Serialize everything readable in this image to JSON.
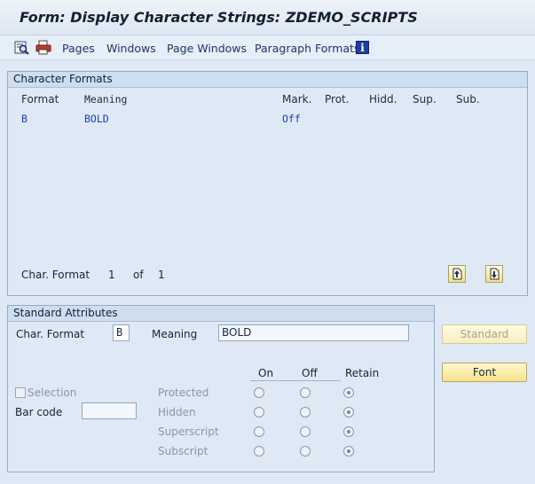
{
  "window": {
    "title": "Form: Display Character Strings: ZDEMO_SCRIPTS"
  },
  "toolbar": {
    "icons": [
      "find-icon",
      "print-icon"
    ],
    "links": [
      "Pages",
      "Windows",
      "Page Windows",
      "Paragraph Formats"
    ],
    "info_icon": "i"
  },
  "character_formats": {
    "title": "Character Formats",
    "columns": [
      "Format",
      "Meaning",
      "Mark.",
      "Prot.",
      "Hidd.",
      "Sup.",
      "Sub."
    ],
    "rows": [
      {
        "format": "B",
        "meaning": "BOLD",
        "mark": "Off"
      }
    ],
    "footer": {
      "label": "Char. Format",
      "current": "1",
      "of": "of",
      "total": "1"
    }
  },
  "standard_attributes": {
    "title": "Standard Attributes",
    "char_format_label": "Char. Format",
    "char_format_value": "B",
    "meaning_label": "Meaning",
    "meaning_value": "BOLD",
    "col_on": "On",
    "col_off": "Off",
    "col_retain": "Retain",
    "selection_label": "Selection",
    "bar_code_label": "Bar code",
    "bar_code_value": "",
    "attributes": [
      "Protected",
      "Hidden",
      "Superscript",
      "Subscript"
    ]
  },
  "buttons": {
    "standard": "Standard",
    "font": "Font"
  }
}
